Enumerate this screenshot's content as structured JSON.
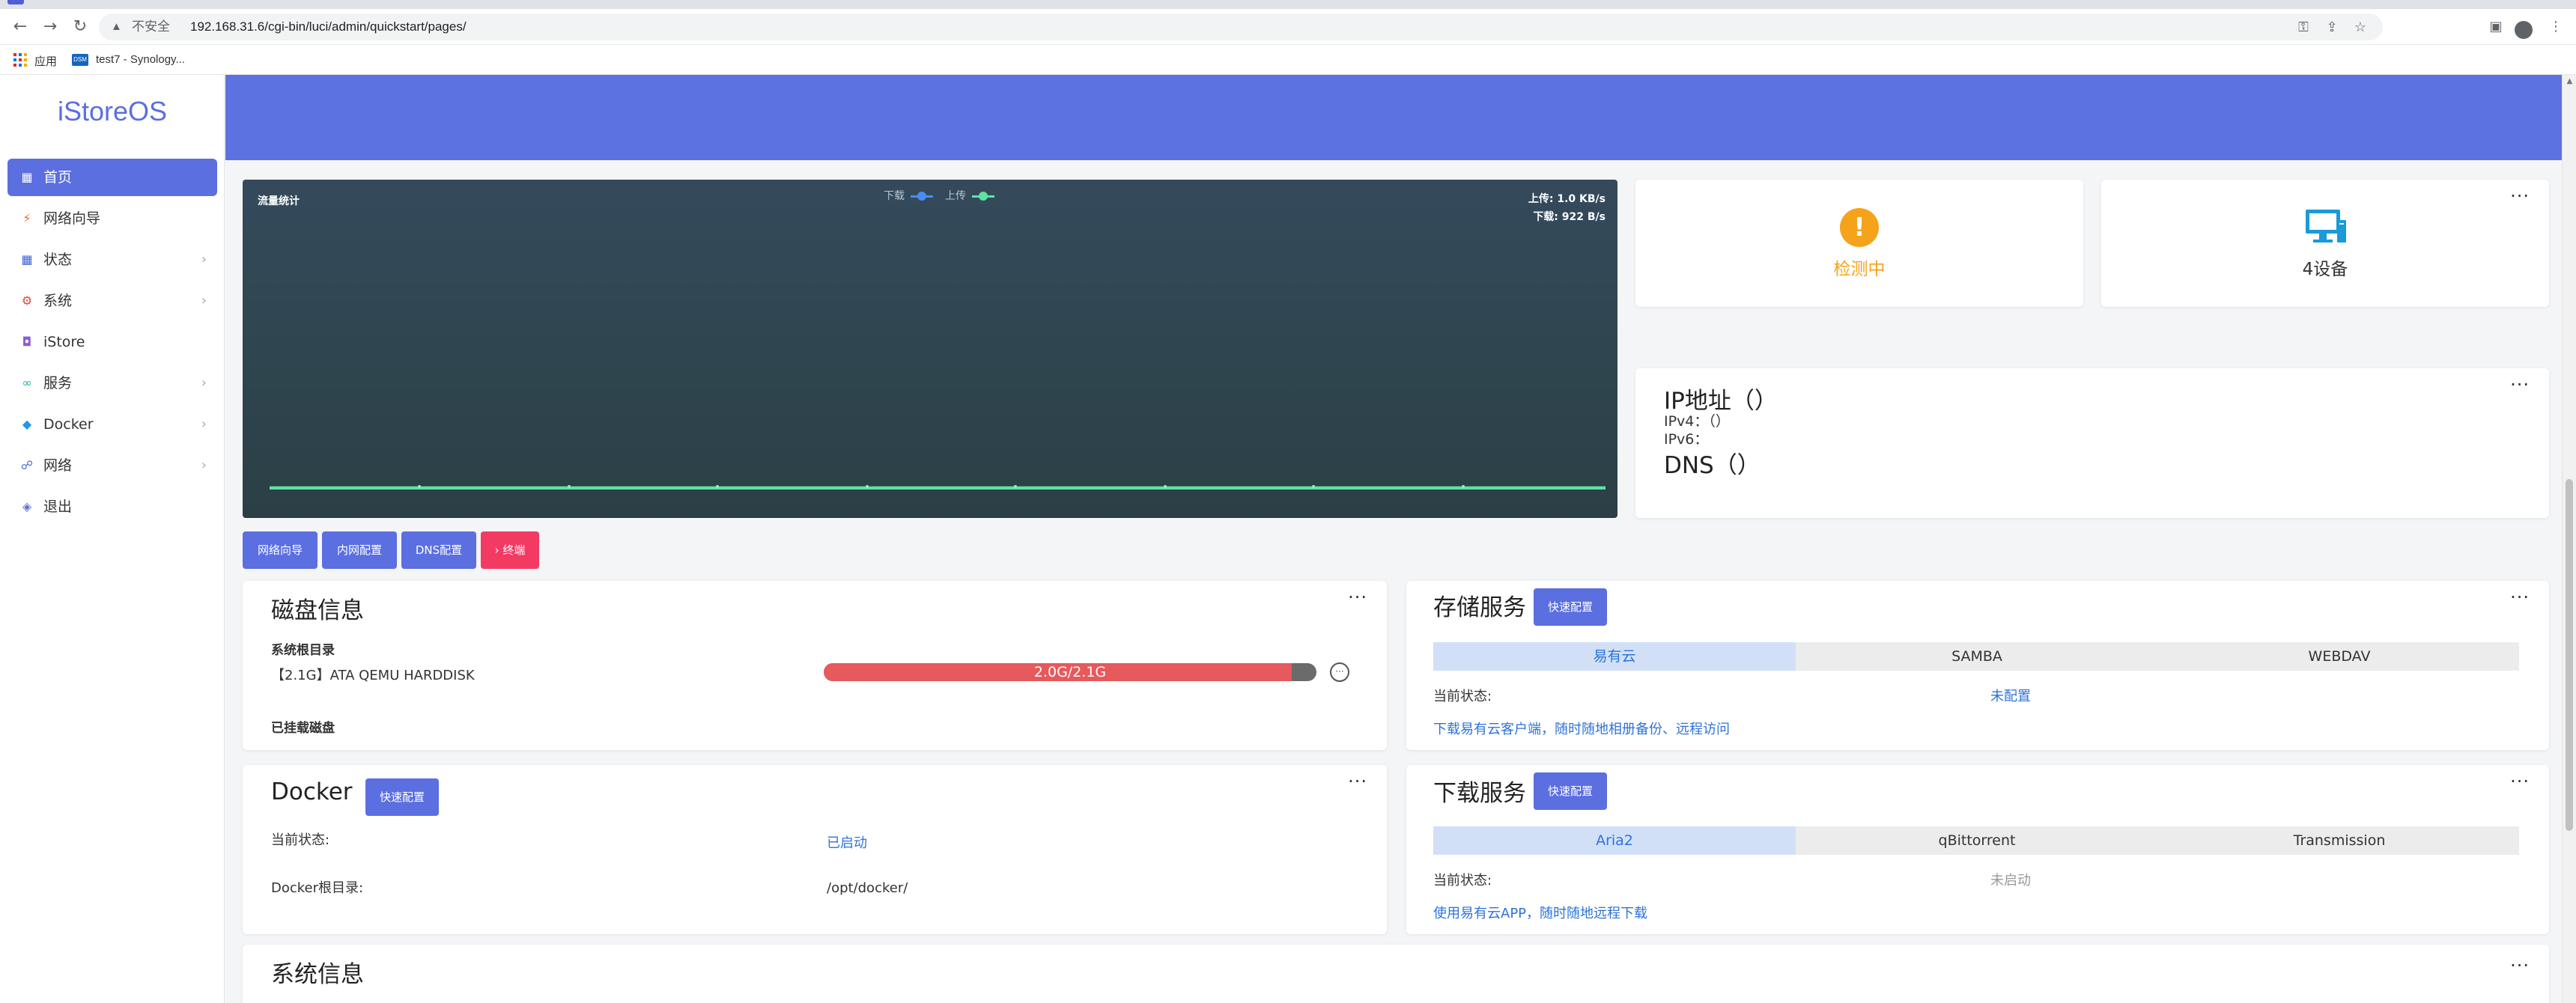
{
  "browser": {
    "nav_icons": [
      "back-icon",
      "forward-icon",
      "reload-icon"
    ],
    "security_text": "不安全",
    "url": "192.168.31.6/cgi-bin/luci/admin/quickstart/pages/",
    "bookmarks": [
      {
        "label": "应用",
        "icon": "apps-grid-icon"
      },
      {
        "label": "test7 - Synology...",
        "icon": "synology-icon"
      }
    ]
  },
  "sidebar": {
    "logo": "iStoreOS",
    "items": [
      {
        "label": "首页",
        "icon": "dashboard-icon",
        "active": true,
        "has_children": false
      },
      {
        "label": "网络向导",
        "icon": "wizard-icon",
        "active": false,
        "has_children": false
      },
      {
        "label": "状态",
        "icon": "status-icon",
        "active": false,
        "has_children": true
      },
      {
        "label": "系统",
        "icon": "gear-icon",
        "active": false,
        "has_children": true
      },
      {
        "label": "iStore",
        "icon": "store-icon",
        "active": false,
        "has_children": false
      },
      {
        "label": "服务",
        "icon": "service-icon",
        "active": false,
        "has_children": true
      },
      {
        "label": "Docker",
        "icon": "docker-icon",
        "active": false,
        "has_children": true
      },
      {
        "label": "网络",
        "icon": "network-icon",
        "active": false,
        "has_children": true
      },
      {
        "label": "退出",
        "icon": "logout-icon",
        "active": false,
        "has_children": false
      }
    ]
  },
  "traffic": {
    "title": "流量统计",
    "legend_download": "下载",
    "legend_upload": "上传",
    "upload_speed": "上传: 1.0 KB/s",
    "download_speed": "下载: 922 B/s",
    "colors": {
      "download": "#4a8cf2",
      "upload": "#5ee3a1"
    }
  },
  "actions": {
    "network_wizard": "网络向导",
    "lan_config": "内网配置",
    "dns_config": "DNS配置",
    "terminal": "› 终端"
  },
  "status": {
    "network_state": "检测中",
    "devices": "4设备"
  },
  "ip_info": {
    "title": "IP地址（）",
    "ipv4": "IPv4：（）",
    "ipv6": "IPv6：",
    "dns": "DNS（）"
  },
  "disk": {
    "title": "磁盘信息",
    "root_label": "系统根目录",
    "disk_name": "【2.1G】ATA QEMU HARDDISK",
    "usage_text": "2.0G/2.1G",
    "usage_fraction": 0.95,
    "mounted_label": "已挂载磁盘"
  },
  "storage": {
    "title": "存储服务",
    "quick_config": "快速配置",
    "tabs": [
      "易有云",
      "SAMBA",
      "WEBDAV"
    ],
    "active_tab": 0,
    "status_label": "当前状态:",
    "status_value": "未配置",
    "link": "下载易有云客户端，随时随地相册备份、远程访问"
  },
  "docker": {
    "title": "Docker",
    "quick_config": "快速配置",
    "status_label": "当前状态:",
    "status_value": "已启动",
    "root_label": "Docker根目录:",
    "root_value": "/opt/docker/"
  },
  "download": {
    "title": "下载服务",
    "quick_config": "快速配置",
    "tabs": [
      "Aria2",
      "qBittorrent",
      "Transmission"
    ],
    "active_tab": 0,
    "status_label": "当前状态:",
    "status_value": "未启动",
    "link": "使用易有云APP，随时随地远程下载"
  },
  "system": {
    "title": "系统信息"
  }
}
